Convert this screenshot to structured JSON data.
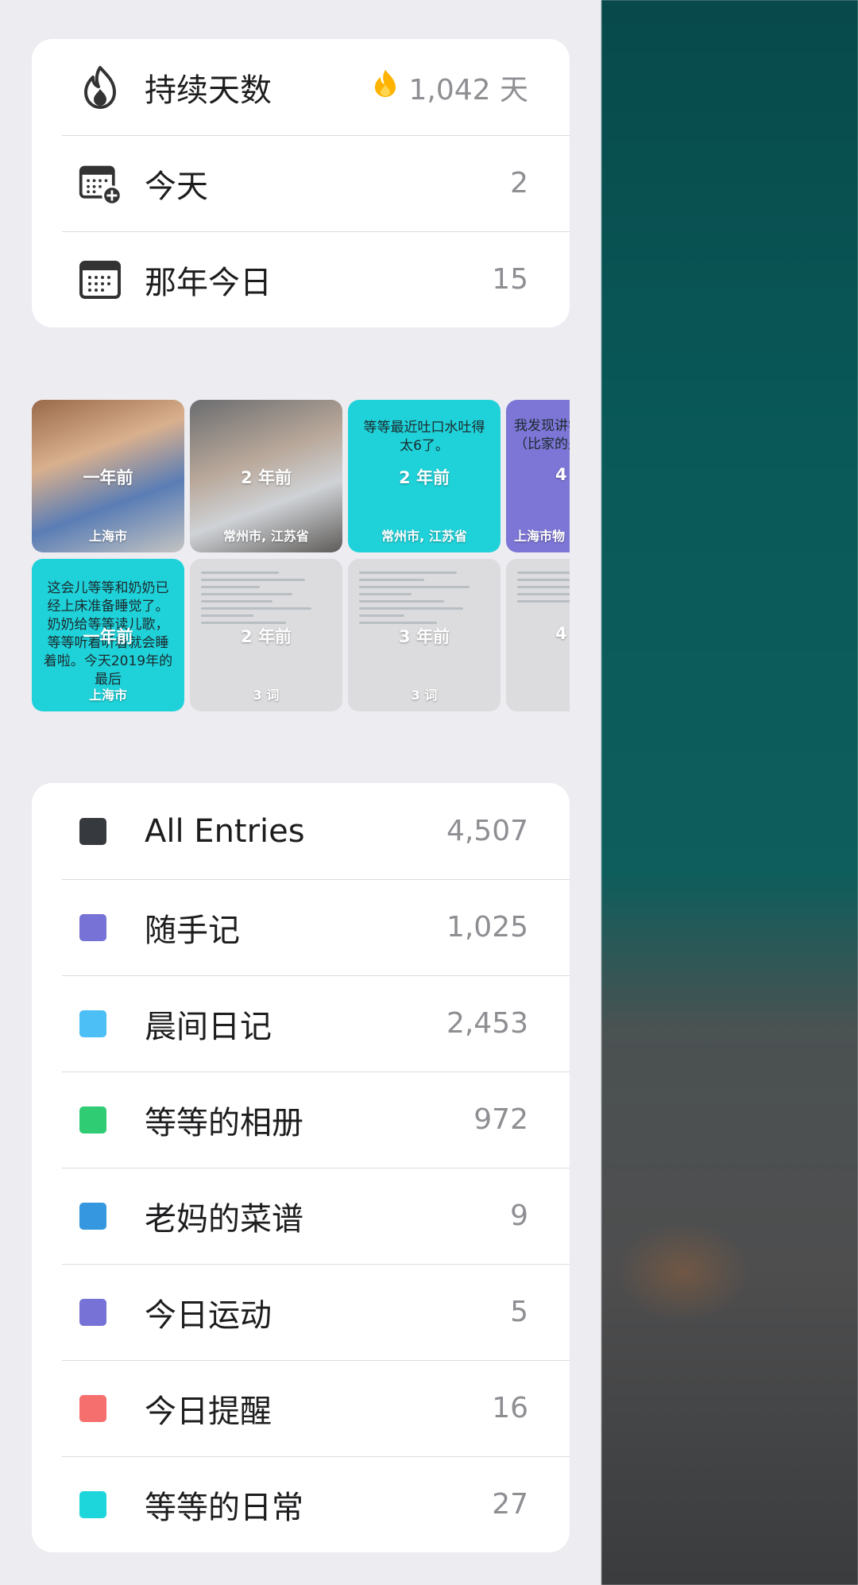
{
  "stats": {
    "streak_label": "持续天数",
    "streak_value": "1,042 天",
    "today_label": "今天",
    "today_count": "2",
    "onthisday_label": "那年今日",
    "onthisday_count": "15"
  },
  "memories": [
    {
      "years": "一年前",
      "location": "上海市",
      "kind": "photo"
    },
    {
      "years": "2 年前",
      "location": "常州市, 江苏省",
      "kind": "photo"
    },
    {
      "years": "2 年前",
      "location": "常州市, 江苏省",
      "kind": "text",
      "text": "等等最近吐口水吐得太6了。"
    },
    {
      "years": "4",
      "location": "上海市物",
      "kind": "text",
      "text": "我发现讲学习给我带发（比家的是异），"
    },
    {
      "years": "一年前",
      "location": "上海市",
      "kind": "text",
      "text": "这会儿等等和奶奶已经上床准备睡觉了。奶奶给等等读儿歌，等等听着听着就会睡着啦。今天2019年的最后"
    },
    {
      "years": "2 年前",
      "location": "3 词",
      "kind": "doc"
    },
    {
      "years": "3 年前",
      "location": "3 词",
      "kind": "doc"
    },
    {
      "years": "4",
      "location": "",
      "kind": "doc"
    }
  ],
  "journals": [
    {
      "name": "All Entries",
      "count": "4,507",
      "color": "#363a3f"
    },
    {
      "name": "随手记",
      "count": "1,025",
      "color": "#7672d6"
    },
    {
      "name": "晨间日记",
      "count": "2,453",
      "color": "#4dbff7"
    },
    {
      "name": "等等的相册",
      "count": "972",
      "color": "#2fcc74"
    },
    {
      "name": "老妈的菜谱",
      "count": "9",
      "color": "#3497df"
    },
    {
      "name": "今日运动",
      "count": "5",
      "color": "#7672d6"
    },
    {
      "name": "今日提醒",
      "count": "16",
      "color": "#f56f6f"
    },
    {
      "name": "等等的日常",
      "count": "27",
      "color": "#1dd6dc"
    }
  ],
  "icons": {
    "streak": "flame-outline-icon",
    "streak_badge": "fire-emoji-icon",
    "today": "calendar-add-icon",
    "onthisday": "calendar-icon"
  }
}
